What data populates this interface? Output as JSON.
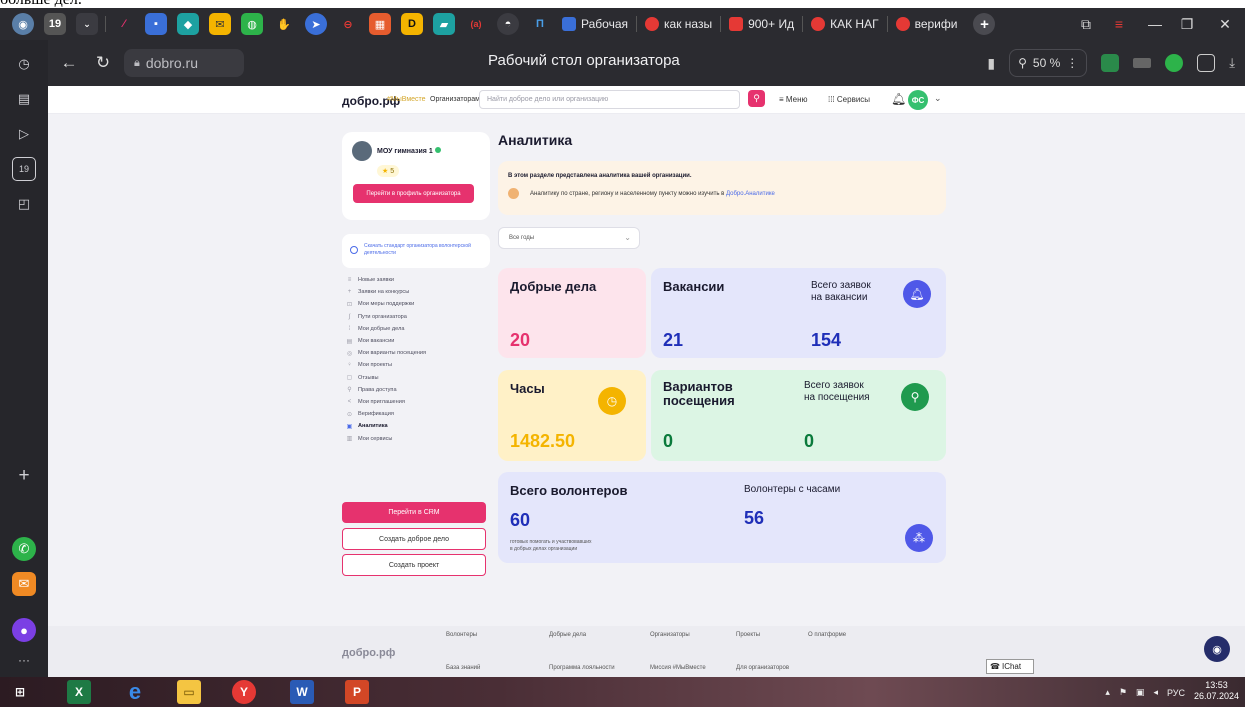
{
  "caption": {
    "text": "больше дел."
  },
  "tabs": {
    "items": [
      {
        "label": "Рабочая",
        "color": "#3a6fd8"
      },
      {
        "label": "как назы",
        "color": "#e53935"
      },
      {
        "label": "900+ Ид",
        "color": "#e53935"
      },
      {
        "label": "КАК НАГ",
        "color": "#e53935"
      },
      {
        "label": "верифи",
        "color": "#e53935"
      }
    ],
    "pinned_count": "19"
  },
  "address": {
    "url": "dobro.ru",
    "page_title": "Рабочий стол организатора",
    "zoom": "50 %"
  },
  "header": {
    "logo": "добро.рф",
    "hashtag": "#МыВместе",
    "org_link": "Организаторам",
    "search_placeholder": "Найти доброе дело или организацию",
    "menu": "Меню",
    "services": "Сервисы",
    "avatar_initials": "ФС"
  },
  "profile": {
    "name": "МОУ гимназия 1",
    "rating": "5",
    "profile_button": "Перейти в профиль организатора",
    "standard_link": "Скачать стандарт организатора волонтерской деятельности"
  },
  "menu": {
    "items": [
      {
        "label": "Новые заявки",
        "icon": "≡"
      },
      {
        "label": "Заявки на конкурсы",
        "icon": "+"
      },
      {
        "label": "Мои меры поддержки",
        "icon": "⊡"
      },
      {
        "label": "Пути организатора",
        "icon": "∫"
      },
      {
        "label": "Мои добрые дела",
        "icon": "⁞"
      },
      {
        "label": "Мои вакансии",
        "icon": "▤"
      },
      {
        "label": "Мои варианты посещения",
        "icon": "◎"
      },
      {
        "label": "Мои проекты",
        "icon": "♀"
      },
      {
        "label": "Отзывы",
        "icon": "▢"
      },
      {
        "label": "Права доступа",
        "icon": "⚲"
      },
      {
        "label": "Мои приглашения",
        "icon": "<"
      },
      {
        "label": "Верификация",
        "icon": "⊙"
      },
      {
        "label": "Аналитика",
        "icon": "▣"
      },
      {
        "label": "Мои сервисы",
        "icon": "▥"
      }
    ],
    "active_index": 12,
    "crm_button": "Перейти в CRM",
    "create_deed": "Создать доброе дело",
    "create_project": "Создать проект"
  },
  "main": {
    "title": "Аналитика",
    "info_line1": "В этом разделе представлена аналитика вашей организации.",
    "info_line2": "Аналитику по стране, региону и населенному пункту можно изучить в",
    "info_link": "Добро.Аналитике",
    "year_select": "Все годы"
  },
  "cards": {
    "good_deeds": {
      "label": "Добрые дела",
      "value": "20",
      "color": "#fde4ec",
      "value_color": "#e6326e"
    },
    "vacancies": {
      "label": "Вакансии",
      "value": "21",
      "sublabel1": "Всего заявок",
      "sublabel2": "на вакансии",
      "value2": "154",
      "color": "#e4e6fb",
      "value_color": "#1f2fb8"
    },
    "hours": {
      "label": "Часы",
      "value": "1482.50",
      "color": "#fff1c7",
      "value_color": "#f4b400"
    },
    "visits": {
      "label1": "Вариантов",
      "label2": "посещения",
      "value": "0",
      "sublabel1": "Всего заявок",
      "sublabel2": "на посещения",
      "value2": "0",
      "color": "#dcf5e4",
      "value_color": "#0a7a3b"
    },
    "volunteers": {
      "label": "Всего волонтеров",
      "value": "60",
      "note1": "готовых помогать и участвовавших",
      "note2": "в добрых делах организации",
      "sublabel": "Волонтеры с часами",
      "value2": "56",
      "color": "#e4e6fb",
      "value_color": "#1f2fb8"
    }
  },
  "footer": {
    "logo": "добро.рф",
    "links": [
      "Волонтеры",
      "Добрые дела",
      "Организаторы",
      "Проекты",
      "О платформе",
      "База знаний",
      "Программа лояльности",
      "Миссия #МыВместе",
      "Для организаторов"
    ],
    "ichat": "IChat"
  },
  "taskbar": {
    "lang": "РУС",
    "time": "13:53",
    "date": "26.07.2024"
  }
}
